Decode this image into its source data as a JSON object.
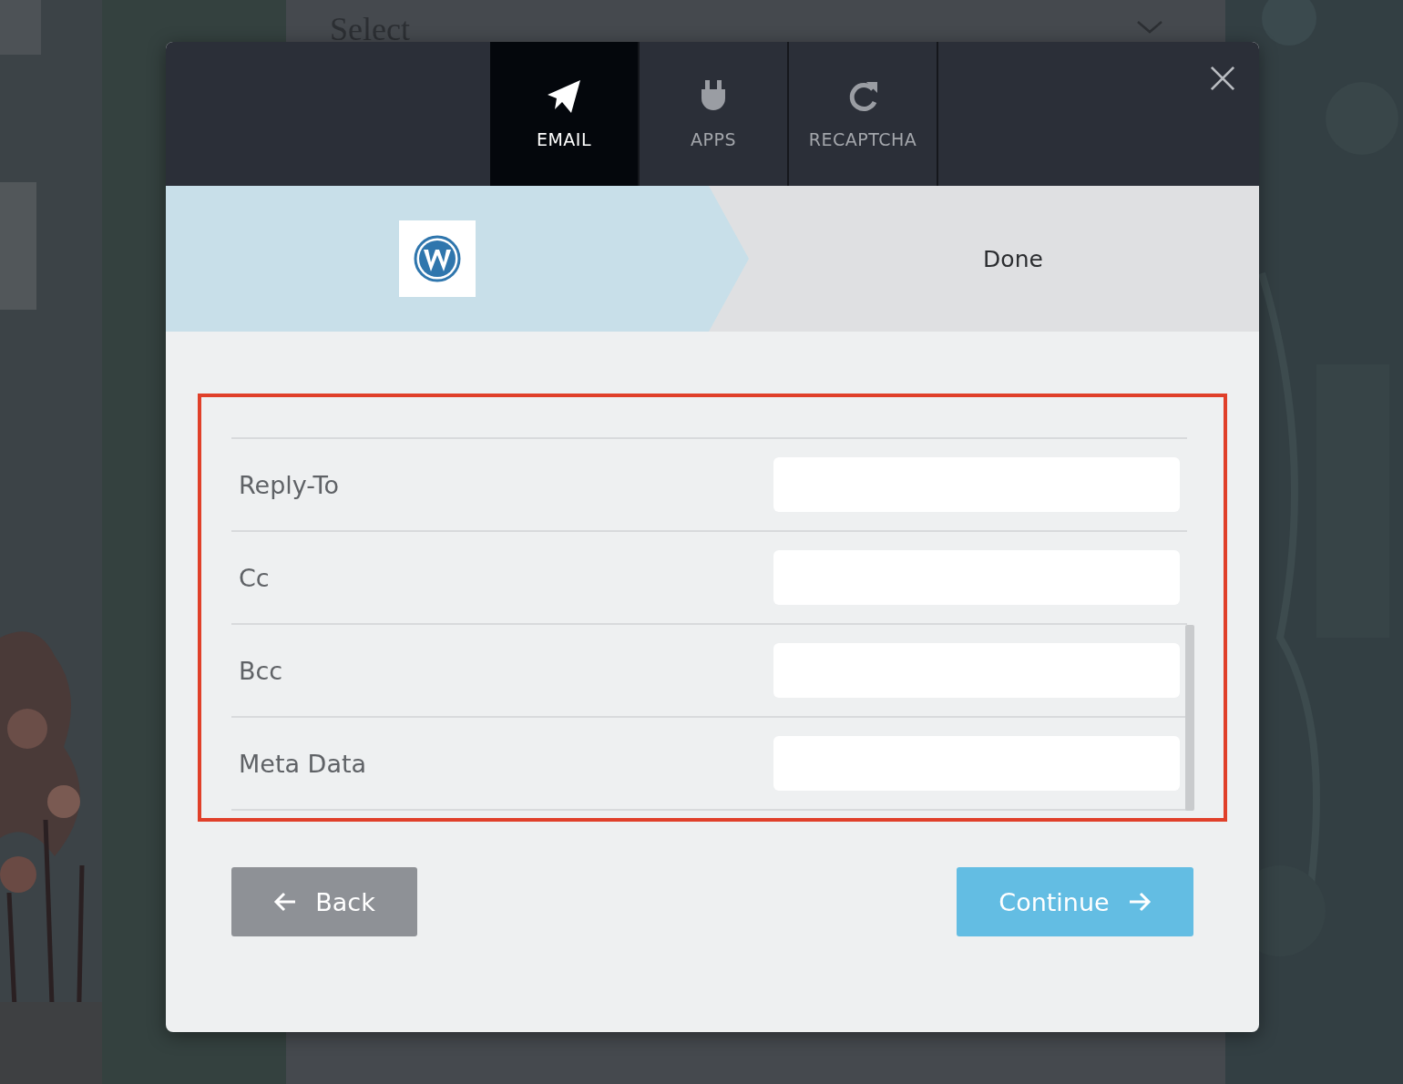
{
  "background": {
    "select_placeholder": "Select"
  },
  "dialog": {
    "tabs": [
      {
        "label": "EMAIL",
        "kind": "send",
        "selected": true
      },
      {
        "label": "APPS",
        "kind": "plug",
        "selected": false
      },
      {
        "label": "RECAPTCHA",
        "kind": "refresh",
        "selected": false
      }
    ],
    "steps": [
      {
        "kind": "logo",
        "selected": true
      },
      {
        "kind": "text",
        "label": "Done",
        "selected": false
      }
    ],
    "fields": [
      {
        "label": "Reply-To"
      },
      {
        "label": "Cc"
      },
      {
        "label": "Bcc"
      },
      {
        "label": "Meta Data"
      }
    ],
    "buttons": [
      {
        "kind": "back",
        "label": "Back"
      },
      {
        "kind": "continue",
        "label": "Continue"
      }
    ]
  }
}
